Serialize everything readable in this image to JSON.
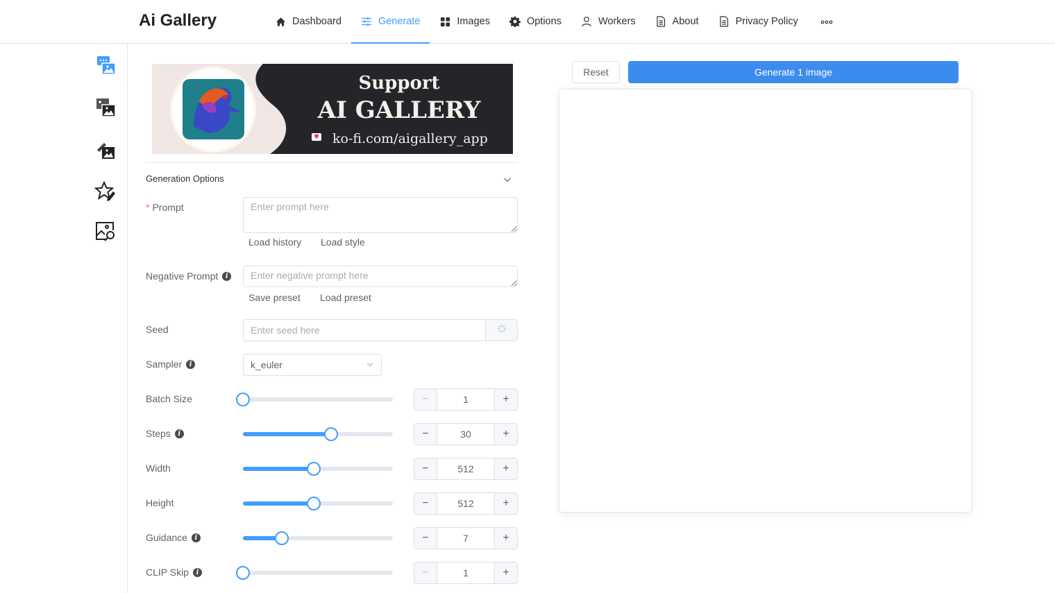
{
  "header": {
    "brand": "Ai Gallery",
    "nav": [
      {
        "label": "Dashboard",
        "icon": "home-icon",
        "active": false
      },
      {
        "label": "Generate",
        "icon": "sliders-icon",
        "active": true
      },
      {
        "label": "Images",
        "icon": "grid-icon",
        "active": false
      },
      {
        "label": "Options",
        "icon": "gear-icon",
        "active": false
      },
      {
        "label": "Workers",
        "icon": "user-icon",
        "active": false
      },
      {
        "label": "About",
        "icon": "document-icon",
        "active": false
      },
      {
        "label": "Privacy Policy",
        "icon": "document-icon",
        "active": false
      }
    ],
    "more_icon": "more-horizontal-icon"
  },
  "sidebar": {
    "items": [
      {
        "name": "text-to-image",
        "icon": "text-to-image-icon",
        "active": true
      },
      {
        "name": "image-to-image",
        "icon": "image-to-image-icon",
        "active": false
      },
      {
        "name": "inpainting",
        "icon": "inpainting-icon",
        "active": false
      },
      {
        "name": "rating",
        "icon": "star-edit-icon",
        "active": false
      },
      {
        "name": "interrogation",
        "icon": "image-search-icon",
        "active": false
      }
    ]
  },
  "banner": {
    "line1": "Support",
    "line2": "AI GALLERY",
    "link": "ko-fi.com/aigallery_app"
  },
  "form": {
    "section_title": "Generation Options",
    "prompt": {
      "label": "Prompt",
      "required_mark": "*",
      "placeholder": "Enter prompt here",
      "value": ""
    },
    "prompt_actions": {
      "load_history": "Load history",
      "load_style": "Load style"
    },
    "negative_prompt": {
      "label": "Negative Prompt",
      "placeholder": "Enter negative prompt here",
      "value": ""
    },
    "negative_actions": {
      "save_preset": "Save preset",
      "load_preset": "Load preset"
    },
    "seed": {
      "label": "Seed",
      "placeholder": "Enter seed here",
      "value": ""
    },
    "sampler": {
      "label": "Sampler",
      "value": "k_euler"
    },
    "sliders": [
      {
        "key": "batch_size",
        "label": "Batch Size",
        "info": false,
        "value": "1",
        "fraction": 0.0,
        "min_disabled": true
      },
      {
        "key": "steps",
        "label": "Steps",
        "info": true,
        "value": "30",
        "fraction": 0.59,
        "min_disabled": false
      },
      {
        "key": "width",
        "label": "Width",
        "info": false,
        "value": "512",
        "fraction": 0.47,
        "min_disabled": false
      },
      {
        "key": "height",
        "label": "Height",
        "info": false,
        "value": "512",
        "fraction": 0.47,
        "min_disabled": false
      },
      {
        "key": "guidance",
        "label": "Guidance",
        "info": true,
        "value": "7",
        "fraction": 0.26,
        "min_disabled": false
      },
      {
        "key": "clip_skip",
        "label": "CLIP Skip",
        "info": true,
        "value": "1",
        "fraction": 0.0,
        "min_disabled": true
      }
    ],
    "info_glyph": "i",
    "minus_glyph": "−",
    "plus_glyph": "+"
  },
  "actions": {
    "reset": "Reset",
    "generate": "Generate 1 image"
  },
  "colors": {
    "accent": "#409eff",
    "generate_button": "#3c8cf0",
    "required": "#f56c6c"
  }
}
